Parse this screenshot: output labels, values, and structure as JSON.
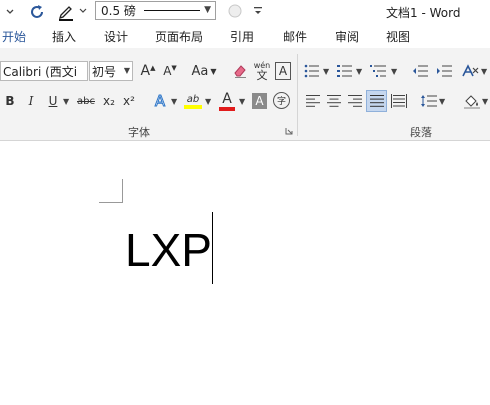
{
  "window": {
    "title": "文档1 - Word"
  },
  "quick_access": {
    "pen_weight": "0.5 磅",
    "icons": [
      "redo-icon",
      "pen-icon",
      "circle-icon",
      "customize-icon"
    ]
  },
  "tabs": [
    {
      "label": "开始",
      "active": true
    },
    {
      "label": "插入"
    },
    {
      "label": "设计"
    },
    {
      "label": "页面布局"
    },
    {
      "label": "引用"
    },
    {
      "label": "邮件"
    },
    {
      "label": "审阅"
    },
    {
      "label": "视图"
    }
  ],
  "font_group": {
    "label": "字体",
    "font_name": "Calibri (西文i",
    "font_size": "初号",
    "grow_label": "A",
    "shrink_label": "A",
    "case_label": "Aa",
    "phonetic_top": "wén",
    "phonetic_bottom": "文",
    "border_label": "A",
    "bold": "B",
    "italic": "I",
    "underline": "U",
    "strike": "abc",
    "subscript": "x₂",
    "superscript": "x²",
    "effects": "A",
    "highlight": "ab",
    "font_color": "A",
    "shading": "A",
    "enclose": "字"
  },
  "paragraph_group": {
    "label": "段落"
  },
  "document": {
    "text": "LXP"
  },
  "colors": {
    "accent": "#2b579a",
    "ribbon_bg": "#f3f3f3",
    "highlight": "#ffff00",
    "font_red": "#e11b1b"
  }
}
